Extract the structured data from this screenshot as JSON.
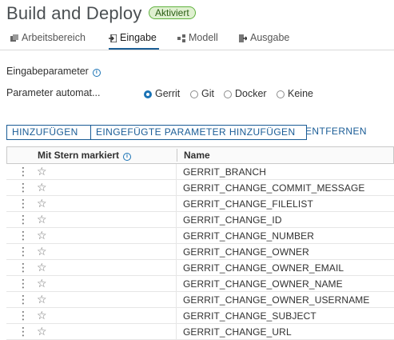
{
  "header": {
    "title": "Build and Deploy",
    "status_badge": "Aktiviert"
  },
  "tabs": [
    {
      "label": "Arbeitsbereich",
      "active": false
    },
    {
      "label": "Eingabe",
      "active": true
    },
    {
      "label": "Modell",
      "active": false
    },
    {
      "label": "Ausgabe",
      "active": false
    }
  ],
  "section": {
    "title": "Eingabeparameter"
  },
  "auto_params": {
    "label": "Parameter automat...",
    "options": [
      "Gerrit",
      "Git",
      "Docker",
      "Keine"
    ],
    "selected": "Gerrit"
  },
  "toolbar": {
    "add": "HINZUFÜGEN",
    "add_injected": "EINGEFÜGTE PARAMETER HINZUFÜGEN",
    "remove": "ENTFERNEN"
  },
  "grid": {
    "columns": [
      "Mit Stern markiert",
      "Name"
    ],
    "rows": [
      "GERRIT_BRANCH",
      "GERRIT_CHANGE_COMMIT_MESSAGE",
      "GERRIT_CHANGE_FILELIST",
      "GERRIT_CHANGE_ID",
      "GERRIT_CHANGE_NUMBER",
      "GERRIT_CHANGE_OWNER",
      "GERRIT_CHANGE_OWNER_EMAIL",
      "GERRIT_CHANGE_OWNER_NAME",
      "GERRIT_CHANGE_OWNER_USERNAME",
      "GERRIT_CHANGE_SUBJECT",
      "GERRIT_CHANGE_URL"
    ]
  },
  "colors": {
    "accent": "#1a5c96",
    "badge_bg": "#dff0d0",
    "badge_border": "#5fb23e"
  }
}
